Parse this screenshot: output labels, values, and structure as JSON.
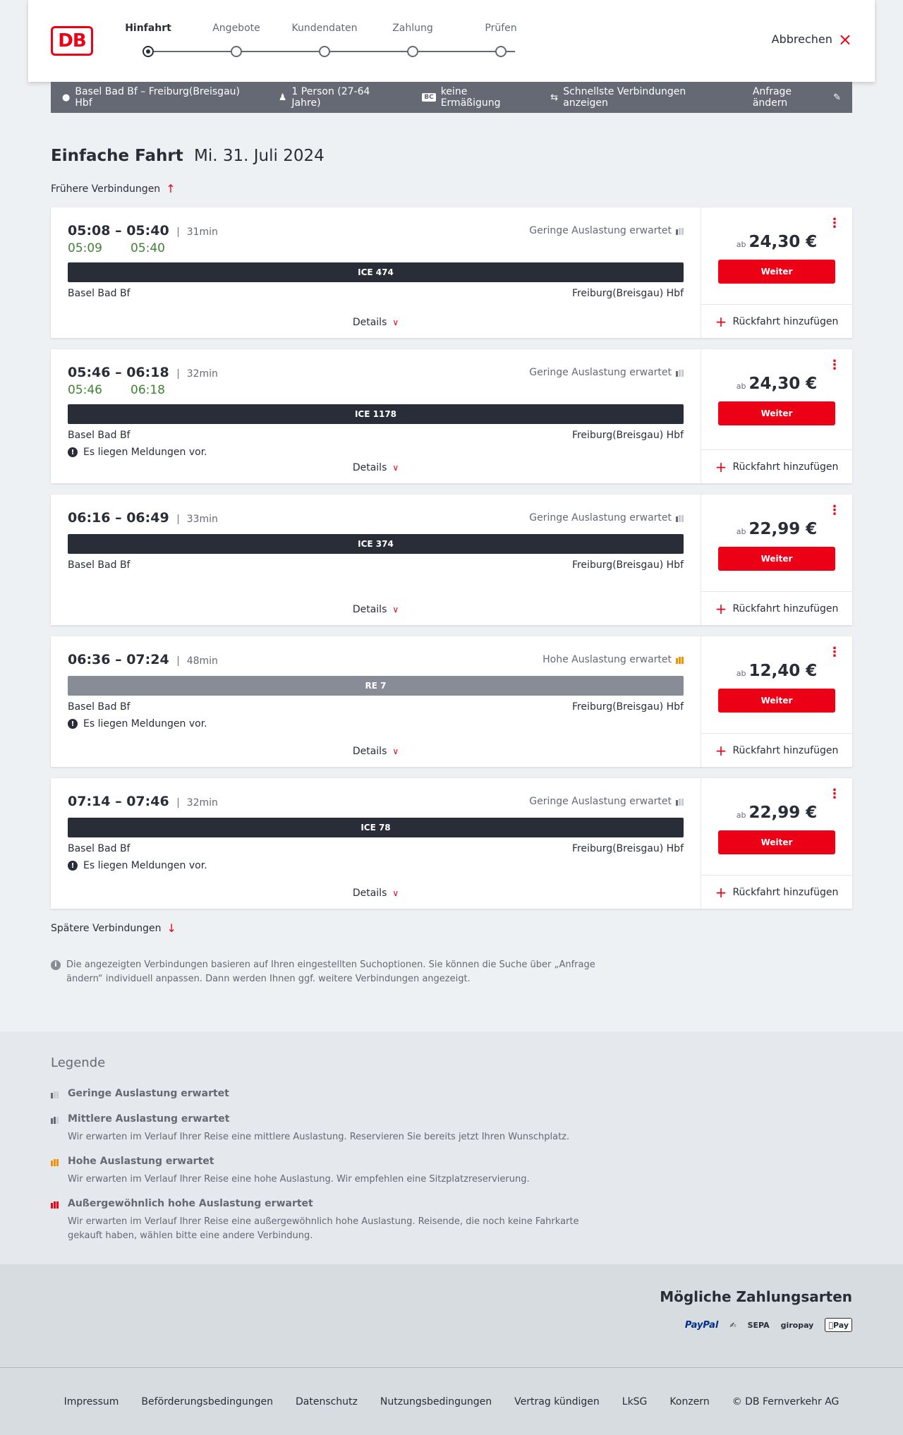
{
  "header": {
    "logo_text": "DB",
    "steps": [
      {
        "label": "Hinfahrt",
        "active": true
      },
      {
        "label": "Angebote",
        "active": false
      },
      {
        "label": "Kundendaten",
        "active": false
      },
      {
        "label": "Zahlung",
        "active": false
      },
      {
        "label": "Prüfen",
        "active": false
      }
    ],
    "cancel_label": "Abbrechen"
  },
  "summary": {
    "route": "Basel Bad Bf – Freiburg(Breisgau) Hbf",
    "travellers": "1 Person (27-64 Jahre)",
    "discount_badge": "BC",
    "discount": "keine Ermäßigung",
    "fastest": "Schnellste Verbindungen anzeigen",
    "edit_label": "Anfrage ändern"
  },
  "title": {
    "trip_type": "Einfache Fahrt",
    "date": "Mi. 31. Juli 2024"
  },
  "earlier_label": "Frühere Verbindungen",
  "later_label": "Spätere Verbindungen",
  "details_label": "Details",
  "continue_label": "Weiter",
  "return_label": "Rückfahrt hinzufügen",
  "price_prefix": "ab",
  "connections": [
    {
      "times": "05:08 – 05:40",
      "duration": "31min",
      "rt_dep": "05:09",
      "rt_arr": "05:40",
      "load": "Geringe Auslastung erwartet",
      "load_level": "low",
      "train": "ICE 474",
      "train_type": "long",
      "from": "Basel Bad Bf",
      "to": "Freiburg(Breisgau) Hbf",
      "notice": "",
      "price": "24,30 €"
    },
    {
      "times": "05:46 – 06:18",
      "duration": "32min",
      "rt_dep": "05:46",
      "rt_arr": "06:18",
      "load": "Geringe Auslastung erwartet",
      "load_level": "low",
      "train": "ICE 1178",
      "train_type": "long",
      "from": "Basel Bad Bf",
      "to": "Freiburg(Breisgau) Hbf",
      "notice": "Es liegen Meldungen vor.",
      "price": "24,30 €"
    },
    {
      "times": "06:16 – 06:49",
      "duration": "33min",
      "rt_dep": "",
      "rt_arr": "",
      "load": "Geringe Auslastung erwartet",
      "load_level": "low",
      "train": "ICE 374",
      "train_type": "long",
      "from": "Basel Bad Bf",
      "to": "Freiburg(Breisgau) Hbf",
      "notice": "",
      "price": "22,99 €"
    },
    {
      "times": "06:36 – 07:24",
      "duration": "48min",
      "rt_dep": "",
      "rt_arr": "",
      "load": "Hohe Auslastung erwartet",
      "load_level": "high",
      "train": "RE 7",
      "train_type": "regional",
      "from": "Basel Bad Bf",
      "to": "Freiburg(Breisgau) Hbf",
      "notice": "Es liegen Meldungen vor.",
      "price": "12,40 €"
    },
    {
      "times": "07:14 – 07:46",
      "duration": "32min",
      "rt_dep": "",
      "rt_arr": "",
      "load": "Geringe Auslastung erwartet",
      "load_level": "low",
      "train": "ICE 78",
      "train_type": "long",
      "from": "Basel Bad Bf",
      "to": "Freiburg(Breisgau) Hbf",
      "notice": "Es liegen Meldungen vor.",
      "price": "22,99 €"
    }
  ],
  "info_text": "Die angezeigten Verbindungen basieren auf Ihren eingestellten Suchoptionen. Sie können die Suche über „Anfrage ändern“ individuell anpassen. Dann werden Ihnen ggf. weitere Verbindungen angezeigt.",
  "legend": {
    "title": "Legende",
    "items": [
      {
        "title": "Geringe Auslastung erwartet",
        "desc": "",
        "level": "low"
      },
      {
        "title": "Mittlere Auslastung erwartet",
        "desc": "Wir erwarten im Verlauf Ihrer Reise eine mittlere Auslastung. Reservieren Sie bereits jetzt Ihren Wunschplatz.",
        "level": "mid"
      },
      {
        "title": "Hohe Auslastung erwartet",
        "desc": "Wir erwarten im Verlauf Ihrer Reise eine hohe Auslastung. Wir empfehlen eine Sitzplatzreservierung.",
        "level": "high"
      },
      {
        "title": "Außergewöhnlich hohe Auslastung erwartet",
        "desc": "Wir erwarten im Verlauf Ihrer Reise eine außergewöhnlich hohe Auslastung. Reisende, die noch keine Fahrkarte gekauft haben, wählen bitte eine andere Verbindung.",
        "level": "extreme"
      }
    ]
  },
  "payment": {
    "title": "Mögliche Zahlungsarten",
    "methods": [
      "PayPal",
      "SEPA",
      "giropay",
      "Pay"
    ]
  },
  "footer": {
    "links": [
      "Impressum",
      "Beförderungsbedingungen",
      "Datenschutz",
      "Nutzungsbedingungen",
      "Vertrag kündigen",
      "LkSG",
      "Konzern",
      "© DB Fernverkehr AG"
    ]
  },
  "colors": {
    "accent": "#ec0016",
    "realtime": "#408335",
    "summary_bar": "#646973",
    "high_load": "#f39200"
  }
}
